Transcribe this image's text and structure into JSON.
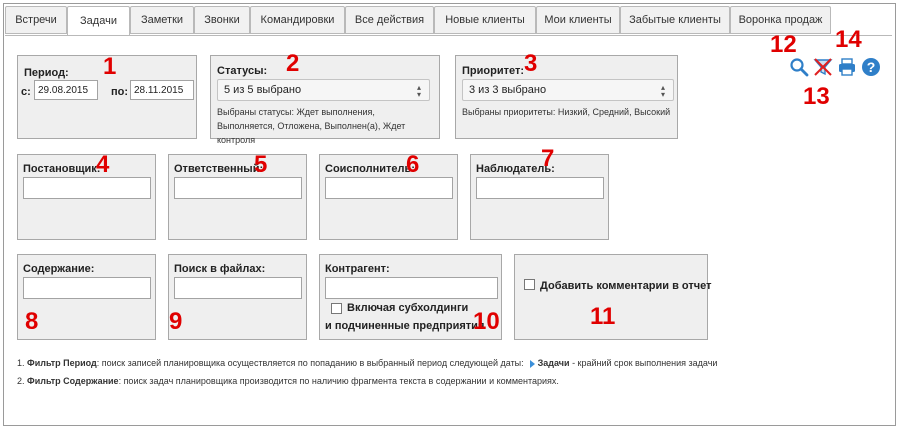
{
  "tabs": [
    {
      "label": "Встречи",
      "active": false
    },
    {
      "label": "Задачи",
      "active": true
    },
    {
      "label": "Заметки",
      "active": false
    },
    {
      "label": "Звонки",
      "active": false
    },
    {
      "label": "Командировки",
      "active": false
    },
    {
      "label": "Все действия",
      "active": false
    },
    {
      "label": "Новые клиенты",
      "active": false
    },
    {
      "label": "Мои клиенты",
      "active": false
    },
    {
      "label": "Забытые клиенты",
      "active": false
    },
    {
      "label": "Воронка продаж",
      "active": false
    }
  ],
  "period": {
    "label": "Период:",
    "from_label": "с:",
    "from_value": "29.08.2015",
    "to_label": "по:",
    "to_value": "28.11.2015"
  },
  "statuses": {
    "label": "Статусы:",
    "selected": "5 из 5 выбрано",
    "note": "Выбраны статусы: Ждет выполнения, Выполняется, Отложена, Выполнен(а), Ждет контроля"
  },
  "priority": {
    "label": "Приоритет:",
    "selected": "3 из 3 выбрано",
    "note": "Выбраны приоритеты: Низкий, Средний, Высокий"
  },
  "assigner": {
    "label": "Постановщик:",
    "value": ""
  },
  "responsible": {
    "label": "Ответственный:",
    "value": ""
  },
  "coexecutor": {
    "label": "Соисполнитель:",
    "value": ""
  },
  "observer": {
    "label": "Наблюдатель:",
    "value": ""
  },
  "content": {
    "label": "Содержание:",
    "value": ""
  },
  "file_search": {
    "label": "Поиск в файлах:",
    "value": ""
  },
  "counterparty": {
    "label": "Контрагент:",
    "value": "",
    "checkbox_line1": "Включая субхолдинги",
    "checkbox_line2": "и подчиненные предприятия",
    "checked": false
  },
  "comments": {
    "label": "Добавить комментарии в отчет",
    "checked": false
  },
  "numbers": [
    "1",
    "2",
    "3",
    "4",
    "5",
    "6",
    "7",
    "8",
    "9",
    "10",
    "11",
    "12",
    "13",
    "14"
  ],
  "icons": {
    "search": "search-icon",
    "clear": "clear-filter-icon",
    "print": "print-icon",
    "help": "help-icon"
  },
  "footnotes": {
    "f1_num": "1.",
    "f1_bold": "Фильтр Период",
    "f1_text": ": поиск записей планировщика осуществляется по попаданию в выбранный период следующей даты:",
    "f1_bold2": "Задачи",
    "f1_text2": " - крайний срок выполнения задачи",
    "f2_num": "2.",
    "f2_bold": "Фильтр Содержание",
    "f2_text": ": поиск задач планировщика производится по наличию фрагмента текста в содержании и комментариях."
  },
  "colors": {
    "accent_number": "#e00000",
    "icon_blue": "#2f7fc8",
    "box_bg": "#efefef"
  }
}
